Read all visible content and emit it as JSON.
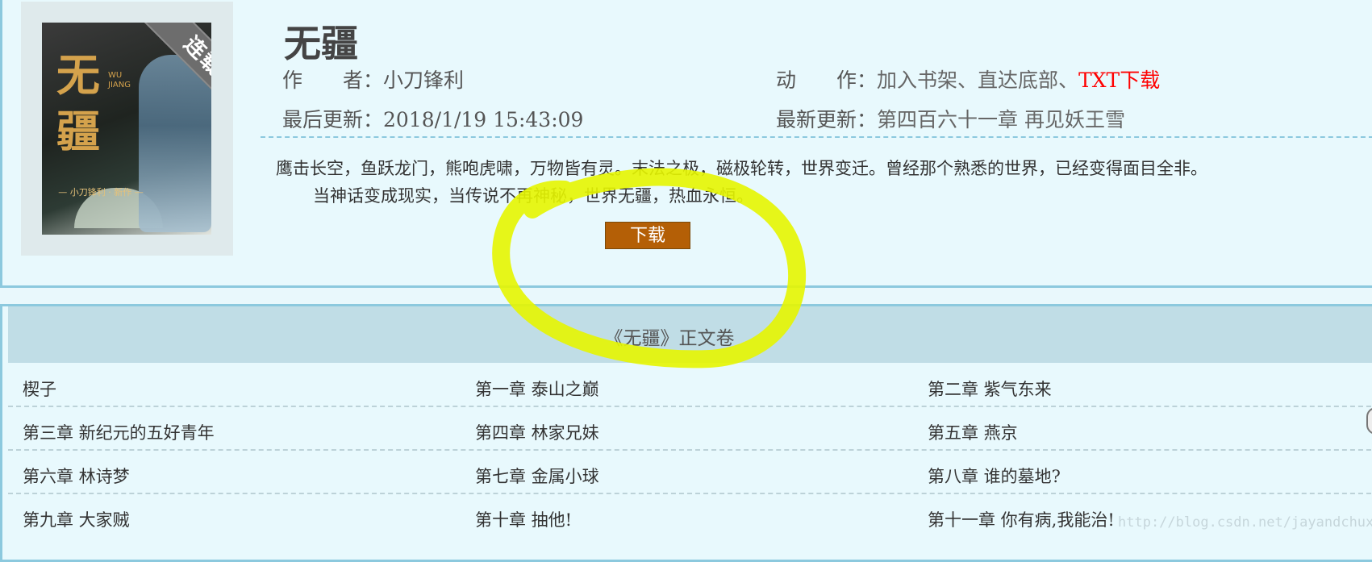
{
  "book": {
    "title": "无疆",
    "status_ribbon": "连载中",
    "cover": {
      "title_chars": [
        "无",
        "疆"
      ],
      "pinyin": [
        "WU",
        "JIANG"
      ],
      "author_line": "— 小刀锋利 · 新作 —"
    },
    "author_label": "作　　者：",
    "author": "小刀锋利",
    "actions_label": "动　　作：",
    "actions": [
      {
        "label": "加入书架",
        "color": "#666666"
      },
      {
        "label": "、",
        "color": "#666666"
      },
      {
        "label": "直达底部",
        "color": "#666666"
      },
      {
        "label": "、",
        "color": "#666666"
      },
      {
        "label": "TXT下载",
        "color": "#ff0000"
      }
    ],
    "updated_label": "最后更新：",
    "updated": "2018/1/19 15:43:09",
    "latest_label": "最新更新：",
    "latest_chapter": "第四百六十一章 再见妖王雪",
    "description_line1": "鹰击长空，鱼跃龙门，熊咆虎啸，万物皆有灵。末法之极，磁极轮转，世界变迁。曾经那个熟悉的世界，已经变得面目全非。",
    "description_line2": "当神话变成现实，当传说不再神秘，世界无疆，热血永恒。",
    "download_label": "下载"
  },
  "volume": {
    "title": "《无疆》正文卷"
  },
  "chapters": [
    [
      "楔子",
      "第一章 泰山之巅",
      "第二章 紫气东来"
    ],
    [
      "第三章 新纪元的五好青年",
      "第四章 林家兄妹",
      "第五章 燕京"
    ],
    [
      "第六章 林诗梦",
      "第七章 金属小球",
      "第八章 谁的墓地?"
    ],
    [
      "第九章 大家贼",
      "第十章 抽他!",
      "第十一章 你有病,我能治!"
    ]
  ],
  "watermark": "http://blog.csdn.net/jayandchuxu",
  "colors": {
    "accent_border": "#8cc9de",
    "button": "#b45f06",
    "highlight": "#e6f500",
    "link_red": "#ff0000"
  }
}
